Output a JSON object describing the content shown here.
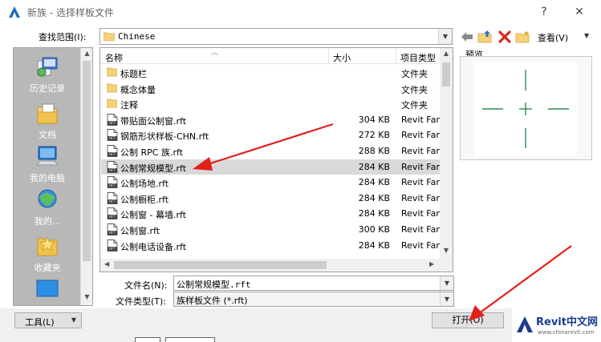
{
  "window": {
    "title": "新族 - 选择样板文件",
    "help_glyph": "?",
    "close_glyph": "✕"
  },
  "toolbar": {
    "look_in_label": "查找范围(I):",
    "look_in_value": "Chinese",
    "view_label": "查看(V)",
    "icons": [
      "back-arrow-icon",
      "up-folder-icon",
      "delete-icon",
      "new-folder-icon"
    ]
  },
  "places": [
    {
      "label": "历史记录",
      "icon": "history-icon"
    },
    {
      "label": "文档",
      "icon": "documents-icon"
    },
    {
      "label": "我的电脑",
      "icon": "computer-icon"
    },
    {
      "label": "我的...",
      "icon": "network-icon"
    },
    {
      "label": "收藏夹",
      "icon": "favorites-icon"
    }
  ],
  "file_list": {
    "columns": [
      "名称",
      "大小",
      "项目类型"
    ],
    "rows": [
      {
        "name": "标题栏",
        "size": "",
        "type": "文件夹",
        "kind": "folder"
      },
      {
        "name": "概念体量",
        "size": "",
        "type": "文件夹",
        "kind": "folder"
      },
      {
        "name": "注释",
        "size": "",
        "type": "文件夹",
        "kind": "folder"
      },
      {
        "name": "带贴面公制窗.rft",
        "size": "304 KB",
        "type": "Revit Fam",
        "kind": "rft"
      },
      {
        "name": "钢筋形状样板-CHN.rft",
        "size": "272 KB",
        "type": "Revit Fam",
        "kind": "rft"
      },
      {
        "name": "公制 RPC 族.rft",
        "size": "288 KB",
        "type": "Revit Fam",
        "kind": "rft"
      },
      {
        "name": "公制常规模型.rft",
        "size": "284 KB",
        "type": "Revit Fam",
        "kind": "rft",
        "selected": true
      },
      {
        "name": "公制场地.rft",
        "size": "284 KB",
        "type": "Revit Fam",
        "kind": "rft"
      },
      {
        "name": "公制橱柜.rft",
        "size": "284 KB",
        "type": "Revit Fam",
        "kind": "rft"
      },
      {
        "name": "公制窗 - 幕墙.rft",
        "size": "284 KB",
        "type": "Revit Fam",
        "kind": "rft"
      },
      {
        "name": "公制窗.rft",
        "size": "300 KB",
        "type": "Revit Fam",
        "kind": "rft"
      },
      {
        "name": "公制电话设备.rft",
        "size": "284 KB",
        "type": "Revit Fam",
        "kind": "rft"
      }
    ]
  },
  "preview": {
    "label": "预览"
  },
  "form": {
    "file_name_label": "文件名(N):",
    "file_name_value": "公制常规模型.rft",
    "file_type_label": "文件类型(T):",
    "file_type_value": "族样板文件 (*.rft)"
  },
  "buttons": {
    "tools_label": "工具(L)",
    "open_label": "打开(O)"
  },
  "watermark": {
    "brand": "Revit中文网",
    "url": "www.chinarevit.com"
  },
  "colors": {
    "places_bg": "#b8b8b8",
    "selected_row": "#d9d9d9",
    "crosshair": "#2e8b57",
    "annotation_arrow": "#e0201b",
    "brand_blue": "#1a3b8f"
  }
}
